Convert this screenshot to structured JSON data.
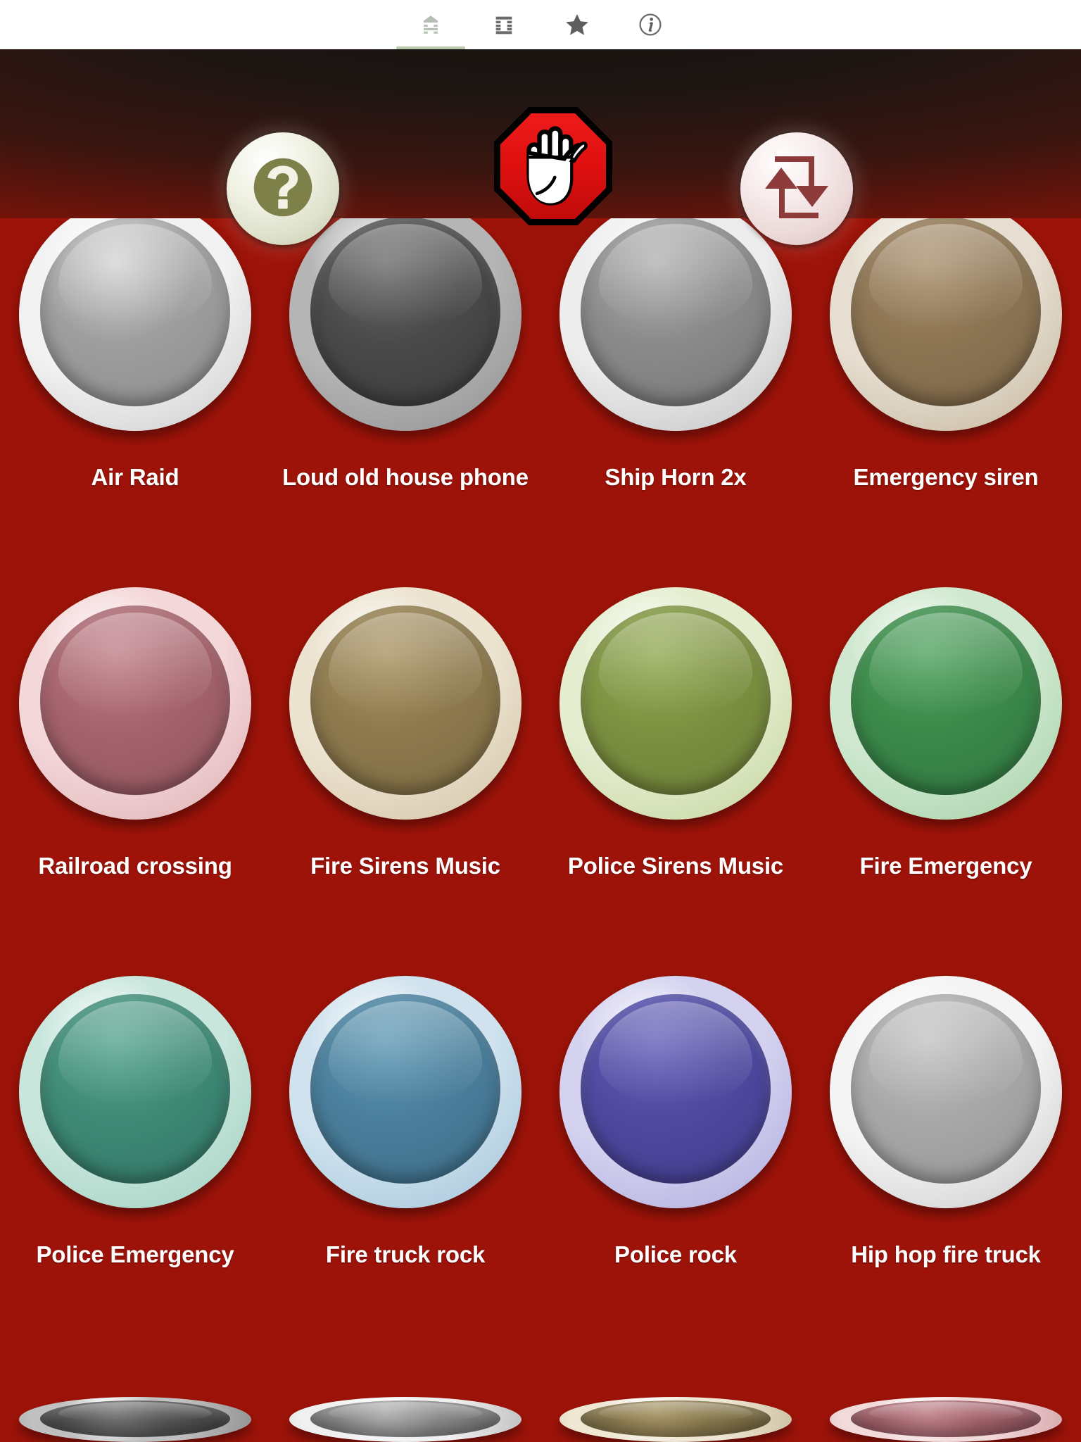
{
  "tabs": [
    {
      "id": "tab-sounds",
      "icon": "document-icon",
      "active": true
    },
    {
      "id": "tab-list",
      "icon": "list-icon",
      "active": false
    },
    {
      "id": "tab-favorites",
      "icon": "star-icon",
      "active": false
    },
    {
      "id": "tab-info",
      "icon": "info-circle-icon",
      "active": false
    }
  ],
  "controls": {
    "help": {
      "label": "?",
      "icon": "question-mark-icon",
      "disc_color": "#eff1e2",
      "mark_color": "#7d8048"
    },
    "stop": {
      "icon": "stop-hand-icon",
      "octagon_color": "#e01010",
      "border_color": "#000000",
      "hand_color": "#ffffff"
    },
    "loop": {
      "icon": "repeat-loop-icon",
      "disc_color": "#f6eaea",
      "mark_color": "#8d3a3a"
    }
  },
  "theme": {
    "body_bg": "#9d1309",
    "header_top": "#171310",
    "header_bottom": "#8d1208",
    "tabbar_bg": "#ffffff",
    "label_color": "#ffffff",
    "active_tab_underline": "#b9c7ad"
  },
  "sounds": [
    {
      "label": "Air Raid",
      "ring": "#f2f2f2",
      "ring2": "#c9c9c9",
      "dome": "#9e9e9e",
      "dome2": "#8c8c8c",
      "gloss": "#d6d6d6"
    },
    {
      "label": "Loud old house phone",
      "ring": "#b5b5b5",
      "ring2": "#8e8e8e",
      "dome": "#4a4a4a",
      "dome2": "#3a3a3a",
      "gloss": "#6e6e6e"
    },
    {
      "label": "Ship Horn 2x",
      "ring": "#ededed",
      "ring2": "#bdbdbd",
      "dome": "#8b8b8b",
      "dome2": "#757575",
      "gloss": "#b3b3b3"
    },
    {
      "label": "Emergency siren",
      "ring": "#e6ded0",
      "ring2": "#c3b49c",
      "dome": "#8d7553",
      "dome2": "#7a6446",
      "gloss": "#ab9270"
    },
    {
      "label": "Railroad crossing",
      "ring": "#f4d7d9",
      "ring2": "#dcaeb2",
      "dome": "#a5636c",
      "dome2": "#8e535c",
      "gloss": "#c2838c"
    },
    {
      "label": "Fire Sirens Music",
      "ring": "#ece3d0",
      "ring2": "#cfc0a2",
      "dome": "#8e7a4e",
      "dome2": "#7b6941",
      "gloss": "#ab9666"
    },
    {
      "label": "Police Sirens Music",
      "ring": "#e4edcf",
      "ring2": "#c2d39b",
      "dome": "#7d9141",
      "dome2": "#6b7d36",
      "gloss": "#96ac58"
    },
    {
      "label": "Fire Emergency",
      "ring": "#cfe8cf",
      "ring2": "#a3cfa5",
      "dome": "#3c8a4a",
      "dome2": "#2f7540",
      "gloss": "#55a564"
    },
    {
      "label": "Police Emergency",
      "ring": "#c9e6dc",
      "ring2": "#9ccfbe",
      "dome": "#3f8a76",
      "dome2": "#327566",
      "gloss": "#5aa692"
    },
    {
      "label": "Fire truck rock",
      "ring": "#cfe2ee",
      "ring2": "#a0c2d8",
      "dome": "#4a7f9c",
      "dome2": "#3d6c87",
      "gloss": "#639bb7"
    },
    {
      "label": "Police rock",
      "ring": "#d4d2ef",
      "ring2": "#adaade",
      "dome": "#4f4aa0",
      "dome2": "#423c8c",
      "gloss": "#6964bb"
    },
    {
      "label": "Hip hop fire truck",
      "ring": "#f4f4f4",
      "ring2": "#c7c7c7",
      "dome": "#a8a8a8",
      "dome2": "#949494",
      "gloss": "#c4c4c4"
    }
  ],
  "sounds_partial": [
    {
      "label": "",
      "ring": "#c0c0c0",
      "ring2": "#949494",
      "dome": "#555555",
      "dome2": "#464646",
      "gloss": "#757575"
    },
    {
      "label": "",
      "ring": "#f0f0f0",
      "ring2": "#c2c2c2",
      "dome": "#8a8a8a",
      "dome2": "#767676",
      "gloss": "#aeaeae"
    },
    {
      "label": "",
      "ring": "#efe7d4",
      "ring2": "#cfc3a4",
      "dome": "#8a7a4e",
      "dome2": "#786941",
      "gloss": "#a69364"
    },
    {
      "label": "",
      "ring": "#f2d9da",
      "ring2": "#d8abaf",
      "dome": "#a5636c",
      "dome2": "#8e535c",
      "gloss": "#c0828b"
    }
  ]
}
